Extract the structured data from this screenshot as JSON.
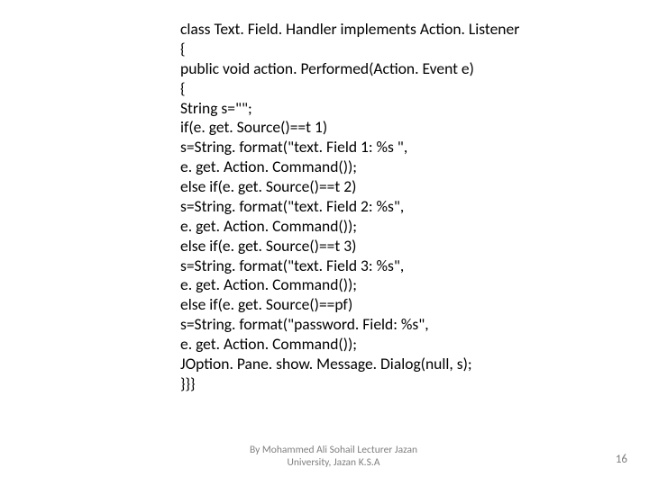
{
  "code": {
    "l1": "class Text. Field. Handler implements Action. Listener",
    "l2": "{",
    "l3": "public void action. Performed(Action. Event e)",
    "l4": "{",
    "l5": "String s=\"\";",
    "l6": "if(e. get. Source()==t 1)",
    "l7": "s=String. format(\"text. Field 1: %s \",",
    "l8": "e. get. Action. Command());",
    "l9": "else if(e. get. Source()==t 2)",
    "l10": "s=String. format(\"text. Field 2: %s\",",
    "l11": "e. get. Action. Command());",
    "l12": "else if(e. get. Source()==t 3)",
    "l13": "s=String. format(\"text. Field 3: %s\",",
    "l14": "e. get. Action. Command());",
    "l15": "else if(e. get. Source()==pf)",
    "l16": "s=String. format(\"password. Field: %s\",",
    "l17": "e. get. Action. Command());",
    "l18": "JOption. Pane. show. Message. Dialog(null, s);",
    "l19": "}}}"
  },
  "footer": {
    "credit_line1": "By Mohammed Ali Sohail Lecturer Jazan",
    "credit_line2": "University, Jazan K.S.A"
  },
  "page_number": "16"
}
